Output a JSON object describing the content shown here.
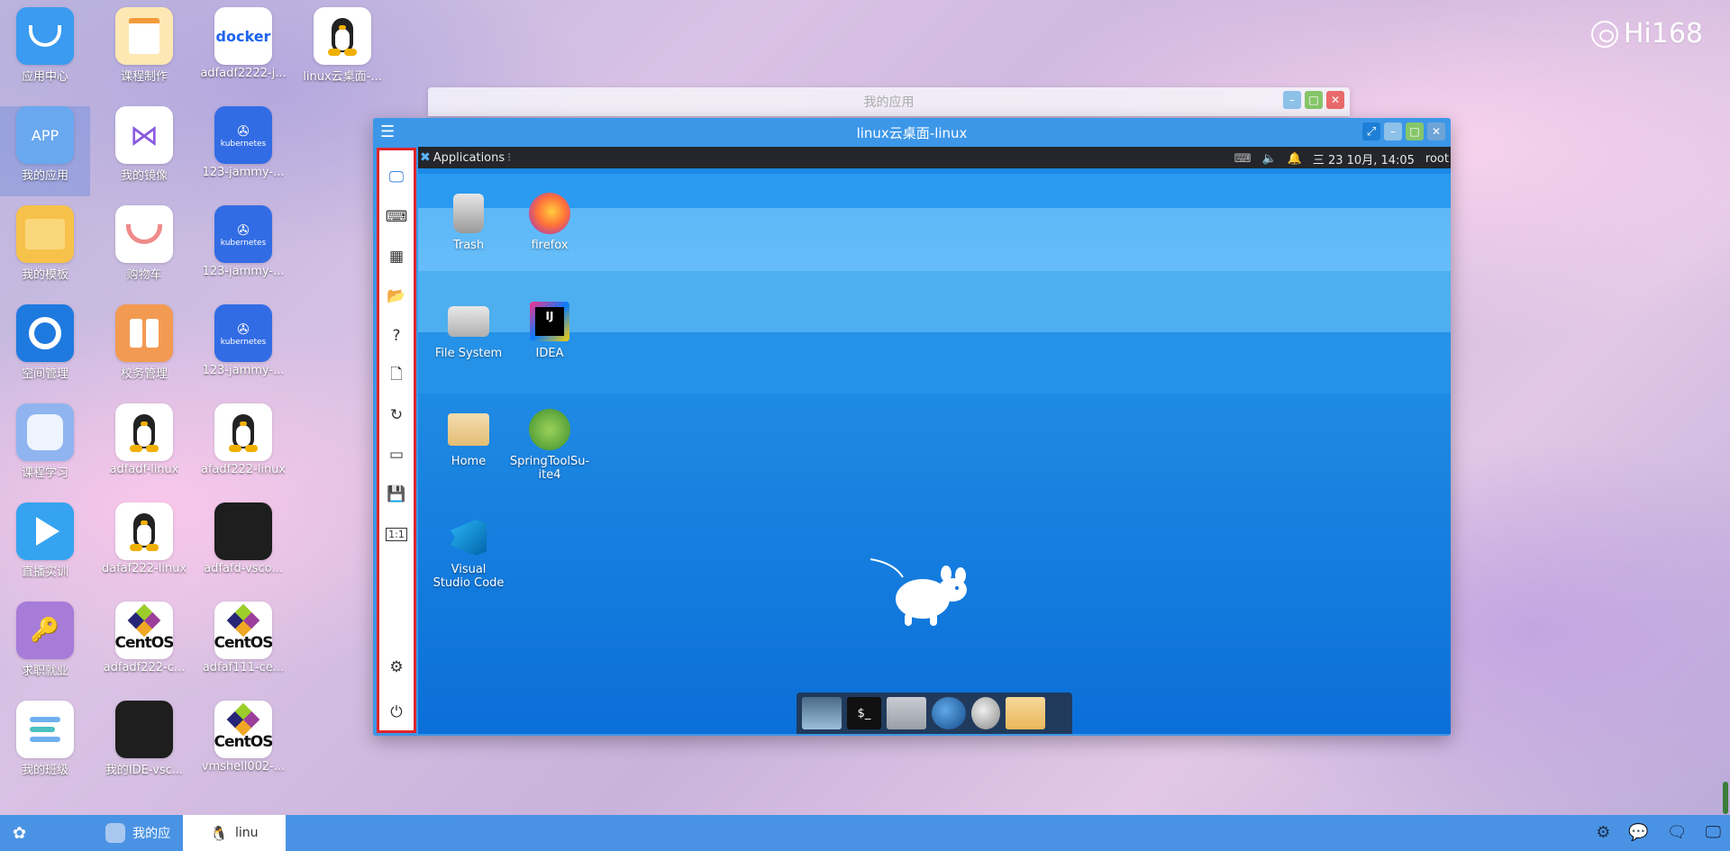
{
  "brand": {
    "name": "Hi168"
  },
  "desktop_icons": [
    {
      "label": "应用中心",
      "icon": "app-center-icon",
      "color": "#3a9bf0"
    },
    {
      "label": "课程制作",
      "icon": "course-make-icon",
      "color": "#f5a53a"
    },
    {
      "label": "adfadf2222-j...",
      "icon": "docker-icon",
      "color": "#ffffff",
      "glyph": "docker"
    },
    {
      "label": "linux云桌面-...",
      "icon": "tux-icon",
      "color": "#ffffff"
    },
    {
      "label": "我的应用",
      "icon": "my-apps-icon",
      "color": "#6aa8f0",
      "glyph": "APP"
    },
    {
      "label": "我的镜像",
      "icon": "my-images-icon",
      "color": "#ffffff"
    },
    {
      "label": "123-jammy-...",
      "icon": "kubernetes-icon",
      "color": "#326ce5",
      "glyph": "kubernetes"
    },
    {
      "label": "我的模板",
      "icon": "my-templates-icon",
      "color": "#f7c24a"
    },
    {
      "label": "购物车",
      "icon": "cart-icon",
      "color": "#ffffff"
    },
    {
      "label": "123-jammy-...",
      "icon": "kubernetes-icon",
      "color": "#326ce5",
      "glyph": "kubernetes"
    },
    {
      "label": "空间管理",
      "icon": "space-mgmt-icon",
      "color": "#1f7ae0"
    },
    {
      "label": "校务管理",
      "icon": "school-mgmt-icon",
      "color": "#f39a52"
    },
    {
      "label": "123-jammy-...",
      "icon": "kubernetes-icon",
      "color": "#326ce5",
      "glyph": "kubernetes"
    },
    {
      "label": "课程学习",
      "icon": "course-learn-icon",
      "color": "#8fb4f0"
    },
    {
      "label": "adfadf-linux",
      "icon": "tux-icon",
      "color": "#ffffff"
    },
    {
      "label": "afadf222-linux",
      "icon": "tux-icon",
      "color": "#ffffff"
    },
    {
      "label": "直播实训",
      "icon": "live-icon",
      "color": "#35a3f0"
    },
    {
      "label": "dafaf222-linux",
      "icon": "tux-icon",
      "color": "#ffffff"
    },
    {
      "label": "adfafd-vsco...",
      "icon": "vscode-screen-icon",
      "color": "#1e1e1e"
    },
    {
      "label": "求职就业",
      "icon": "job-icon",
      "color": "#a77bd8"
    },
    {
      "label": "adfadf222-c...",
      "icon": "centos-icon",
      "color": "#ffffff",
      "glyph": "CentOS"
    },
    {
      "label": "adfaf111-ce...",
      "icon": "centos-icon",
      "color": "#ffffff",
      "glyph": "CentOS"
    },
    {
      "label": "我的班级",
      "icon": "my-class-icon",
      "color": "#ffffff"
    },
    {
      "label": "我的IDE-vsc...",
      "icon": "vscode-screen-icon",
      "color": "#1e1e1e"
    },
    {
      "label": "vmshell002-...",
      "icon": "centos-icon",
      "color": "#ffffff",
      "glyph": "CentOS"
    }
  ],
  "bg_window": {
    "title": "我的应用"
  },
  "main_window": {
    "title": "linux云桌面-linux"
  },
  "sidebar": [
    {
      "name": "sidebar-desktop",
      "icon": "monitor-icon",
      "glyph": "🖵"
    },
    {
      "name": "sidebar-terminal",
      "icon": "terminal-icon",
      "glyph": "⌨"
    },
    {
      "name": "sidebar-apps",
      "icon": "grid-icon",
      "glyph": "▦"
    },
    {
      "name": "sidebar-files",
      "icon": "folder-open-icon",
      "glyph": "📂"
    },
    {
      "name": "sidebar-help",
      "icon": "help-icon",
      "glyph": "?"
    },
    {
      "name": "sidebar-file",
      "icon": "file-icon",
      "glyph": "🗋"
    },
    {
      "name": "sidebar-refresh",
      "icon": "refresh-icon",
      "glyph": "↻"
    },
    {
      "name": "sidebar-card",
      "icon": "card-icon",
      "glyph": "▭"
    },
    {
      "name": "sidebar-save",
      "icon": "save-icon",
      "glyph": "💾"
    },
    {
      "name": "sidebar-scale",
      "icon": "scale-1-1-icon",
      "glyph": "1:1"
    }
  ],
  "sidebar_bottom": [
    {
      "name": "sidebar-settings",
      "icon": "gear-icon",
      "glyph": "⚙"
    },
    {
      "name": "sidebar-power",
      "icon": "power-icon",
      "glyph": "⏻"
    }
  ],
  "xfce_panel": {
    "applications": "Applications",
    "clock": "三 23 10月, 14:05",
    "user": "root"
  },
  "xfce_desktop": [
    {
      "label": "Trash",
      "icon": "trash-icon"
    },
    {
      "label": "firefox",
      "icon": "firefox-icon"
    },
    {
      "label": "File System",
      "icon": "drive-icon"
    },
    {
      "label": "IDEA",
      "icon": "idea-icon"
    },
    {
      "label": "Home",
      "icon": "home-folder-icon"
    },
    {
      "label": "SpringToolSu-ite4",
      "icon": "spring-icon"
    },
    {
      "label": "Visual Studio Code",
      "icon": "vscode-icon"
    }
  ],
  "taskbar": {
    "tabs": [
      {
        "label": "我的应",
        "icon": "app-icon"
      },
      {
        "label": "linu",
        "icon": "tux-icon"
      }
    ]
  }
}
